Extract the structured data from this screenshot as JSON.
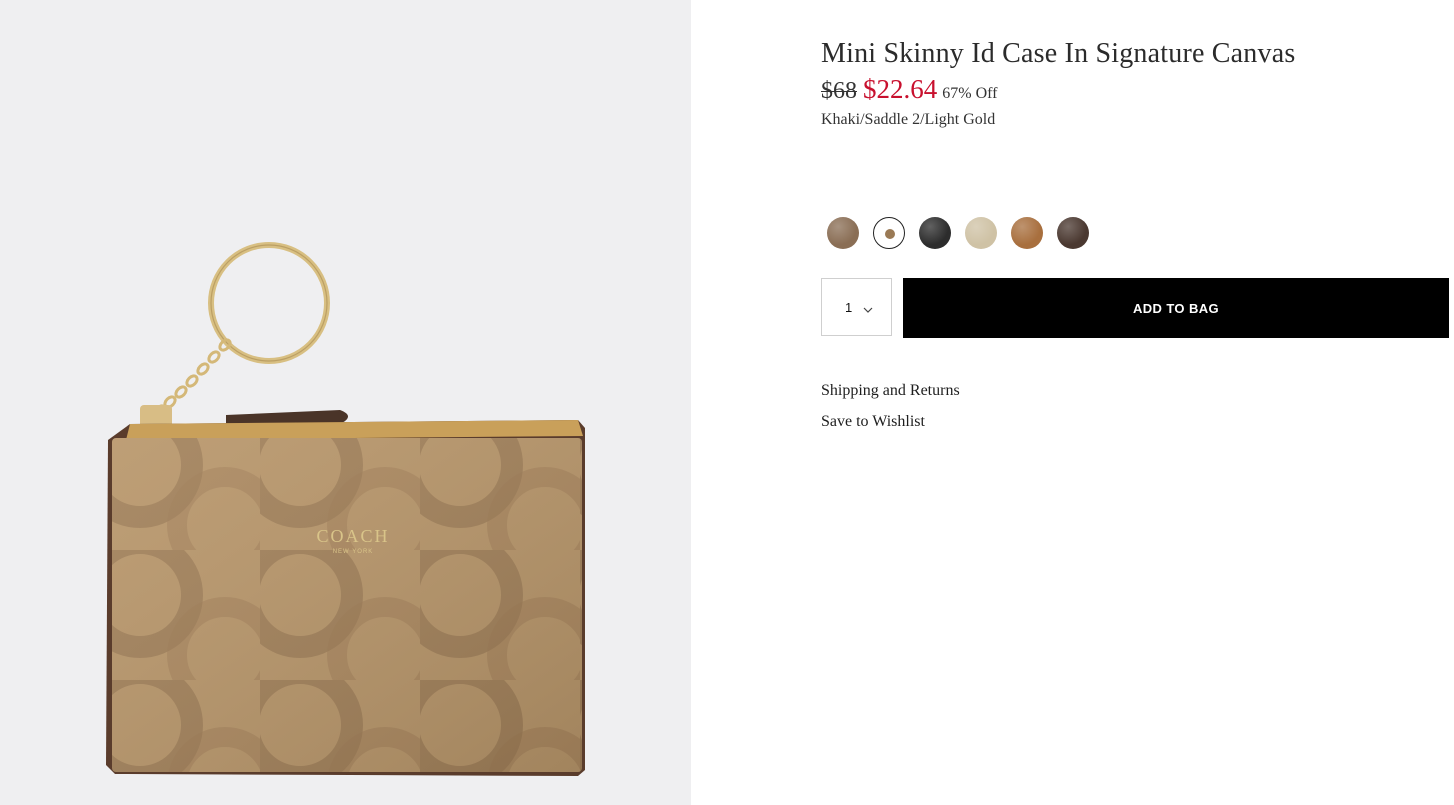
{
  "product": {
    "title": "Mini Skinny Id Case In Signature Canvas",
    "price_original": "$68",
    "price_sale": "$22.64",
    "discount": "67% Off",
    "color_name": "Khaki/Saddle 2/Light Gold",
    "image_logo_text": "COACH",
    "image_logo_subtext": "NEW YORK"
  },
  "swatches": [
    {
      "color": "#8a6e55",
      "selected": false
    },
    {
      "color": "#9a7a55",
      "selected": true
    },
    {
      "color": "#2c2c2c",
      "selected": false
    },
    {
      "color": "#cfc2a5",
      "selected": false
    },
    {
      "color": "#a86f3e",
      "selected": false
    },
    {
      "color": "#4a3830",
      "selected": false
    }
  ],
  "purchase": {
    "quantity": "1",
    "add_to_bag_label": "ADD TO BAG"
  },
  "links": {
    "shipping": "Shipping and Returns",
    "wishlist": "Save to Wishlist"
  },
  "colors": {
    "sale_price": "#c8102e",
    "button_bg": "#000000",
    "image_bg": "#efeff1"
  }
}
